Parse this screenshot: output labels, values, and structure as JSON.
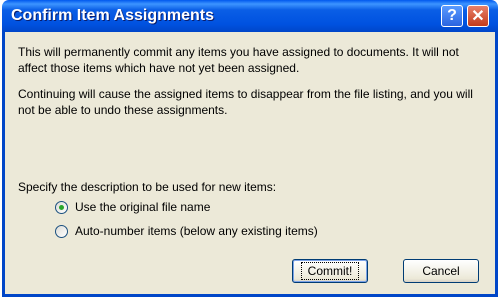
{
  "dialog": {
    "title": "Confirm Item Assignments",
    "help_glyph": "?",
    "close_glyph": "✕"
  },
  "body": {
    "paragraph1": "This will permanently commit any items you have assigned to documents. It will not affect those items which have not yet been assigned.",
    "paragraph2": "Continuing will cause the assigned items to disappear from the file listing, and you will not be able to undo these assignments.",
    "specify_label": "Specify the description to be used for new items:"
  },
  "options": [
    {
      "label": "Use the original file name",
      "checked": true
    },
    {
      "label": "Auto-number items (below any existing items)",
      "checked": false
    }
  ],
  "buttons": {
    "commit": "Commit!",
    "cancel": "Cancel"
  },
  "colors": {
    "titlebar": "#0052e0",
    "client": "#ece9d8"
  }
}
